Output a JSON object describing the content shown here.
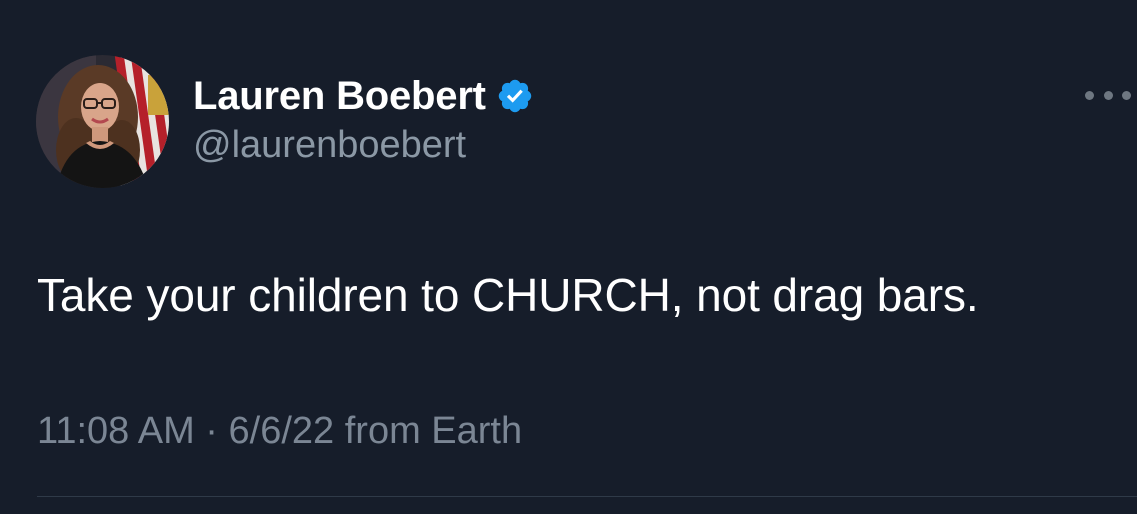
{
  "author": {
    "display_name": "Lauren Boebert",
    "handle": "@laurenboebert",
    "verified": true,
    "verified_color": "#1d9bf0"
  },
  "tweet": {
    "text": "Take your children to CHURCH, not drag bars.",
    "time": "11:08 AM",
    "separator": "·",
    "date": "6/6/22",
    "source": "from Earth"
  },
  "icons": {
    "verified": "verified-badge-icon",
    "more": "more-options-icon"
  },
  "colors": {
    "background": "#161d2a",
    "text_primary": "#ffffff",
    "text_secondary": "#8b98a5"
  }
}
